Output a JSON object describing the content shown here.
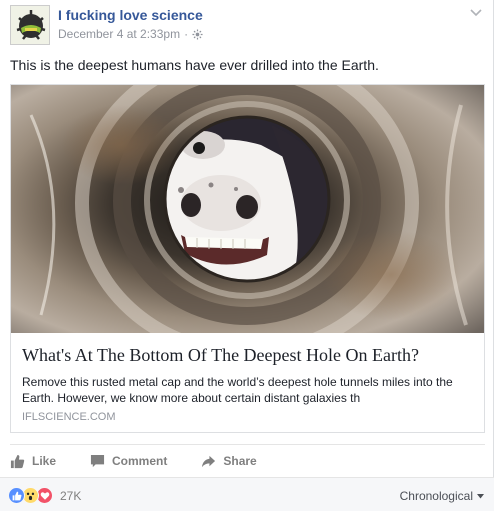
{
  "post": {
    "page_name": "I fucking love science",
    "timestamp": "December 4 at 2:33pm",
    "separator": "·",
    "privacy_icon": "globe-icon",
    "menu_icon": "chevron-down-icon",
    "text": "This is the deepest humans have ever drilled into the Earth.",
    "link": {
      "title": "What's At The Bottom Of The Deepest Hole On Earth?",
      "description": "Remove this rusted metal cap and the world’s deepest hole tunnels miles into the Earth. However, we know more about certain distant galaxies th",
      "domain": "IFLSCIENCE.COM",
      "image_alt": "cow-face-peering-through-hole"
    },
    "actions": {
      "like": "Like",
      "comment": "Comment",
      "share": "Share"
    },
    "reactions": {
      "types": [
        "like",
        "wow",
        "love"
      ],
      "count": "27K"
    },
    "sort_label": "Chronological"
  },
  "colors": {
    "link_blue": "#365899",
    "meta_gray": "#90949c",
    "like_blue": "#5890ff",
    "love_red": "#f25268",
    "wow_yellow": "#ffda6a"
  }
}
